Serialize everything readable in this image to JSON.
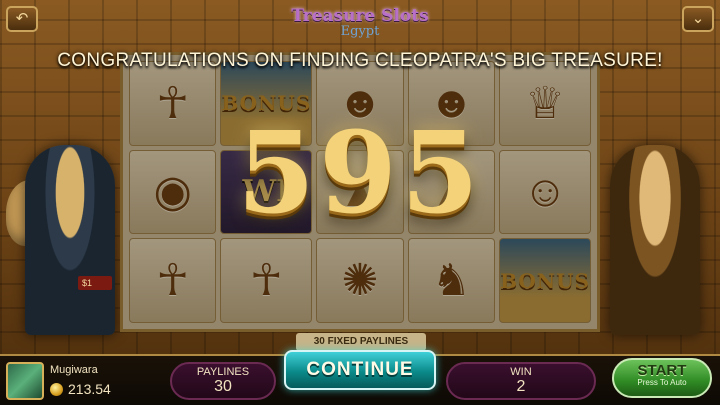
{
  "game": {
    "logo_title": "Treasure Slots",
    "logo_subtitle": "Egypt"
  },
  "overlay": {
    "message": "CONGRATULATIONS ON FINDING CLEOPATRA'S BIG TREASURE!",
    "win_amount": "595"
  },
  "reels": {
    "paylines_tag": "30 FIXED PAYLINES",
    "symbols": [
      {
        "kind": "face",
        "glyph": "☥"
      },
      {
        "kind": "bonus",
        "text": "BONUS"
      },
      {
        "kind": "face",
        "glyph": "☻"
      },
      {
        "kind": "face",
        "glyph": "☻"
      },
      {
        "kind": "face",
        "glyph": "♕"
      },
      {
        "kind": "face",
        "glyph": "◉"
      },
      {
        "kind": "wild",
        "text": "WI"
      },
      {
        "kind": "face",
        "glyph": "▲"
      },
      {
        "kind": "face",
        "glyph": "▲"
      },
      {
        "kind": "face",
        "glyph": "☺"
      },
      {
        "kind": "face",
        "glyph": "☥"
      },
      {
        "kind": "face",
        "glyph": "☥"
      },
      {
        "kind": "face",
        "glyph": "✺"
      },
      {
        "kind": "face",
        "glyph": "♞"
      },
      {
        "kind": "bonus",
        "text": "BONUS"
      }
    ]
  },
  "side": {
    "bet_tag": "$1"
  },
  "bottom_bar": {
    "player_name": "Mugiwara",
    "balance": "213.54",
    "paylines_label": "PAYLINES",
    "paylines_value": "30",
    "continue_label": "CONTINUE",
    "win_label": "WIN",
    "win_value": "2",
    "start_label": "START",
    "start_sub": "Press To Auto"
  },
  "icons": {
    "back": "back-arrow-icon",
    "menu": "chevron-down-icon",
    "coin": "coin-icon"
  },
  "colors": {
    "win_gold": "#f3d27a",
    "continue_teal": "#0b8a8a",
    "start_green": "#2f8a24",
    "pill_purple": "#3a0f2e"
  }
}
